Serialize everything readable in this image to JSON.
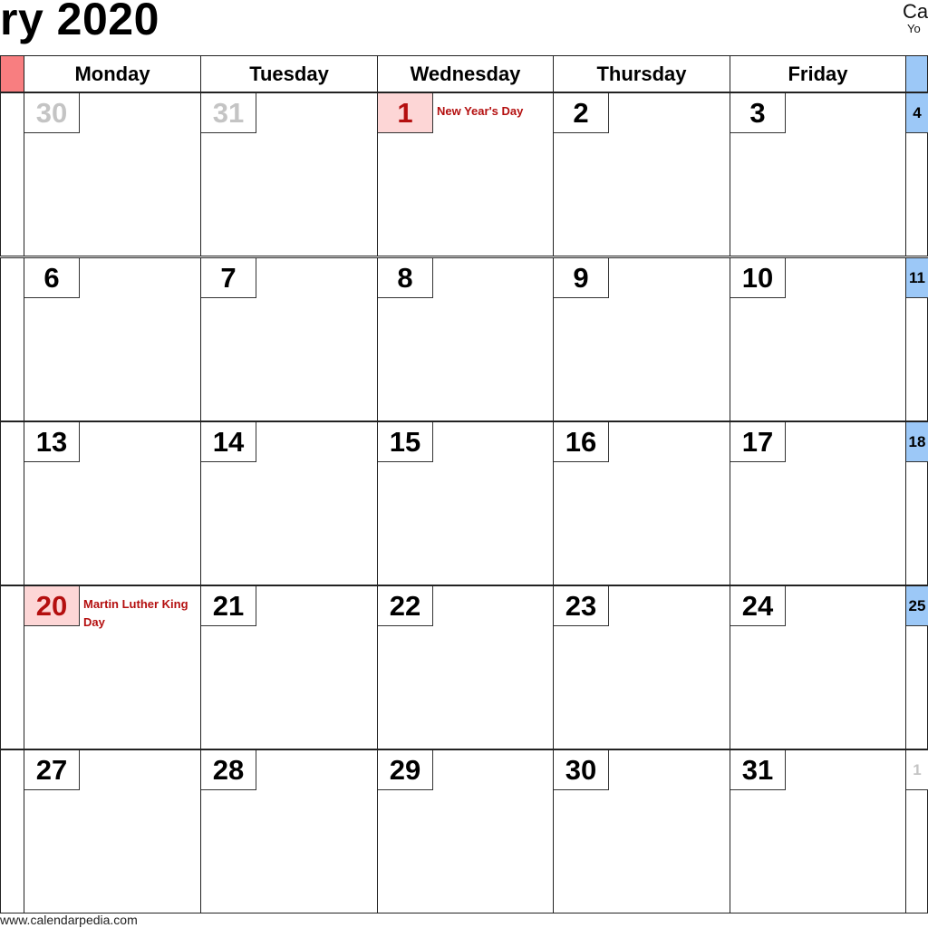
{
  "header": {
    "title": "ry 2020",
    "brand": "Ca",
    "tagline": "Yo"
  },
  "weekdays": [
    "",
    "Monday",
    "Tuesday",
    "Wednesday",
    "Thursday",
    "Friday",
    ""
  ],
  "colors": {
    "sunday_header": "#f87e80",
    "saturday_header": "#9cc8f7",
    "holiday_bg": "#fdd6d6",
    "holiday_text": "#b40f0f",
    "other_month": "#c4c4c4"
  },
  "weeks": [
    [
      {
        "day": ""
      },
      {
        "day": "30",
        "other": true
      },
      {
        "day": "31",
        "other": true
      },
      {
        "day": "1",
        "holiday": "New Year's Day"
      },
      {
        "day": "2"
      },
      {
        "day": "3"
      },
      {
        "day": "4"
      }
    ],
    [
      {
        "day": ""
      },
      {
        "day": "6"
      },
      {
        "day": "7"
      },
      {
        "day": "8"
      },
      {
        "day": "9"
      },
      {
        "day": "10"
      },
      {
        "day": "11"
      }
    ],
    [
      {
        "day": ""
      },
      {
        "day": "13"
      },
      {
        "day": "14"
      },
      {
        "day": "15"
      },
      {
        "day": "16"
      },
      {
        "day": "17"
      },
      {
        "day": "18"
      }
    ],
    [
      {
        "day": ""
      },
      {
        "day": "20",
        "holiday": "Martin Luther King Day"
      },
      {
        "day": "21"
      },
      {
        "day": "22"
      },
      {
        "day": "23"
      },
      {
        "day": "24"
      },
      {
        "day": "25"
      }
    ],
    [
      {
        "day": ""
      },
      {
        "day": "27"
      },
      {
        "day": "28"
      },
      {
        "day": "29"
      },
      {
        "day": "30"
      },
      {
        "day": "31"
      },
      {
        "day": "1",
        "other": true
      }
    ]
  ],
  "footer": "www.calendarpedia.com"
}
